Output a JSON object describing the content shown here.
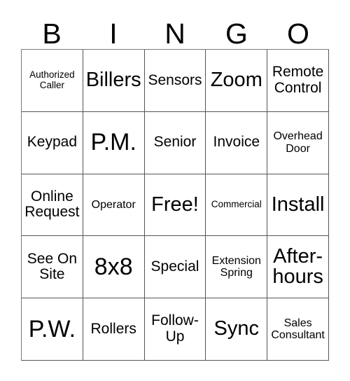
{
  "card": {
    "type": "bingo-card",
    "columns": 5,
    "rows": 5,
    "header": {
      "letters": [
        "B",
        "I",
        "N",
        "G",
        "O"
      ]
    },
    "free_space": {
      "label": "Free!",
      "row": 3,
      "column": 3
    },
    "colors": {
      "background": "#ffffff",
      "text": "#000000",
      "grid_line": "#555555",
      "outer_border": "#7a7a7a"
    },
    "cells": [
      [
        {
          "label": "Authorized Caller",
          "size": "xs"
        },
        {
          "label": "Billers",
          "size": "xl"
        },
        {
          "label": "Sensors",
          "size": "md"
        },
        {
          "label": "Zoom",
          "size": "xl"
        },
        {
          "label": "Remote Control",
          "size": "md"
        }
      ],
      [
        {
          "label": "Keypad",
          "size": "md"
        },
        {
          "label": "P.M.",
          "size": "xxl"
        },
        {
          "label": "Senior",
          "size": "md"
        },
        {
          "label": "Invoice",
          "size": "md"
        },
        {
          "label": "Overhead Door",
          "size": "sm"
        }
      ],
      [
        {
          "label": "Online Request",
          "size": "md"
        },
        {
          "label": "Operator",
          "size": "sm"
        },
        {
          "label": "Free!",
          "size": "xl"
        },
        {
          "label": "Commercial",
          "size": "xs"
        },
        {
          "label": "Install",
          "size": "xl"
        }
      ],
      [
        {
          "label": "See On Site",
          "size": "md"
        },
        {
          "label": "8x8",
          "size": "xxl"
        },
        {
          "label": "Special",
          "size": "md"
        },
        {
          "label": "Extension Spring",
          "size": "sm"
        },
        {
          "label": "After-hours",
          "size": "xl"
        }
      ],
      [
        {
          "label": "P.W.",
          "size": "xxl"
        },
        {
          "label": "Rollers",
          "size": "md"
        },
        {
          "label": "Follow-Up",
          "size": "md"
        },
        {
          "label": "Sync",
          "size": "xl"
        },
        {
          "label": "Sales Consultant",
          "size": "sm"
        }
      ]
    ]
  }
}
